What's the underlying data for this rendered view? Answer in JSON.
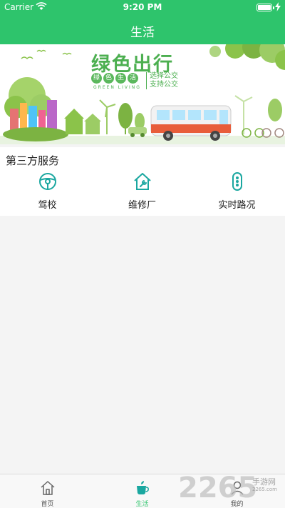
{
  "status_bar": {
    "carrier": "Carrier",
    "time": "9:20 PM"
  },
  "nav": {
    "title": "生活"
  },
  "banner": {
    "title": "绿色出行",
    "pill_chars": [
      "绿",
      "色",
      "生",
      "活"
    ],
    "subtitle_en": "GREEN LIVING",
    "side_line1": "选择公交",
    "side_line2": "支持公交"
  },
  "services": {
    "title": "第三方服务",
    "items": [
      {
        "label": "驾校",
        "icon": "steering-wheel-icon"
      },
      {
        "label": "维修厂",
        "icon": "repair-house-icon"
      },
      {
        "label": "实时路况",
        "icon": "traffic-light-icon"
      }
    ]
  },
  "tabbar": {
    "items": [
      {
        "label": "首页",
        "icon": "home-icon"
      },
      {
        "label": "生活",
        "icon": "cup-icon"
      },
      {
        "label": "我的",
        "icon": "person-icon"
      }
    ],
    "active_index": 1
  },
  "watermark": {
    "number": "2265",
    "site": "手游网",
    "url": "2265.com"
  },
  "colors": {
    "accent": "#2ec46c",
    "banner_green": "#4caf50"
  }
}
